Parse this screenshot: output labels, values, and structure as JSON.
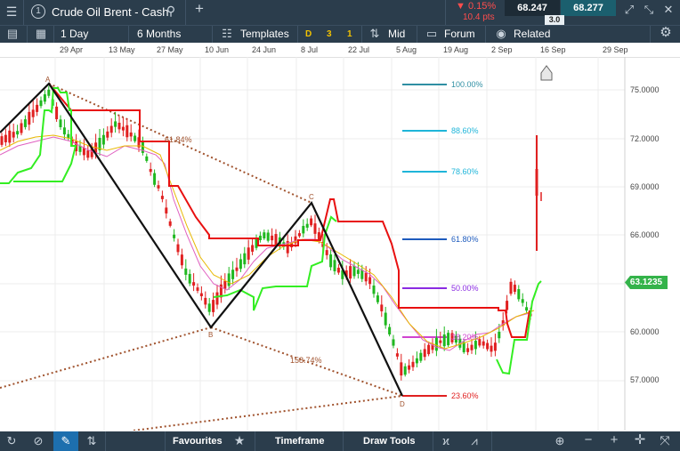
{
  "title": {
    "number": "1",
    "instrument": "Crude Oil Brent - Cash"
  },
  "quote": {
    "change_pct": "▼ 0.15%",
    "change_pts": "10.4 pts",
    "sell": "68.247",
    "buy": "68.277",
    "spread": "3.0"
  },
  "toolbar": {
    "interval": "1 Day",
    "range": "6 Months",
    "templates": "Templates",
    "d": "D",
    "three": "3",
    "one": "1",
    "mid": "Mid",
    "forum": "Forum",
    "related": "Related"
  },
  "dates": [
    "29 Apr",
    "13 May",
    "27 May",
    "10 Jun",
    "24 Jun",
    "8 Jul",
    "22 Jul",
    "5 Aug",
    "19 Aug",
    "2 Sep",
    "16 Sep",
    "29 Sep"
  ],
  "yaxis": [
    "75.0000",
    "72.0000",
    "69.0000",
    "66.0000",
    "60.0000",
    "57.0000"
  ],
  "current_price": "63.1235",
  "fib": [
    {
      "label": "100.00%",
      "color": "#2f8fa3"
    },
    {
      "label": "88.60%",
      "color": "#1fb5d9"
    },
    {
      "label": "78.60%",
      "color": "#1fb5d9"
    },
    {
      "label": "61.80%",
      "color": "#1e5bbd"
    },
    {
      "label": "50.00%",
      "color": "#8a2be2"
    },
    {
      "label": "38.20%",
      "color": "#d044d0"
    },
    {
      "label": "23.60%",
      "color": "#e02020"
    }
  ],
  "pattern": {
    "a": "A",
    "b": "B",
    "c": "C",
    "d": "D",
    "ratio1": "61.84%",
    "ratio2": "158.74%"
  },
  "bottom": {
    "favourites": "Favourites",
    "timeframe": "Timeframe",
    "draw_tools": "Draw Tools"
  },
  "colors": {
    "bar_bg": "#2b3d4c",
    "up": "#1fb81f",
    "down": "#e02020",
    "green_line": "#33ee22",
    "red_line": "#e81010",
    "price_box": "#34b34a"
  }
}
